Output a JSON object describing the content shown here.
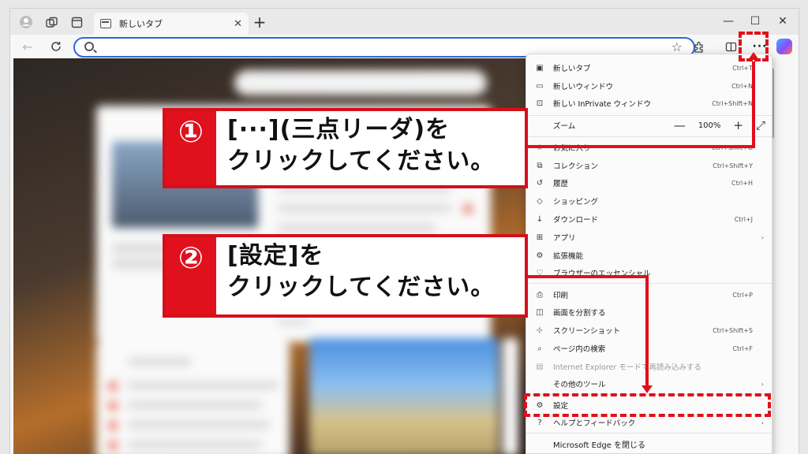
{
  "browser": {
    "tab_title": "新しいタブ",
    "tab_close": "✕",
    "new_tab": "+",
    "window_controls": {
      "minimize": "—",
      "maximize": "☐",
      "close": "✕"
    },
    "more_button_label": "···"
  },
  "menu": {
    "items": [
      {
        "label": "新しいタブ",
        "shortcut": "Ctrl+T",
        "icon": "new-tab-icon",
        "glyph": "▣"
      },
      {
        "label": "新しいウィンドウ",
        "shortcut": "Ctrl+N",
        "icon": "window-icon",
        "glyph": "▭"
      },
      {
        "label": "新しい InPrivate ウィンドウ",
        "shortcut": "Ctrl+Shift+N",
        "icon": "inprivate-icon",
        "glyph": "⊡"
      },
      {
        "label": "ズーム",
        "zoom_value": "100%",
        "zoom_out": "—",
        "zoom_in": "+",
        "fullscreen": "⤢"
      },
      {
        "label": "お気に入り",
        "shortcut": "Ctrl+Shift+O",
        "icon": "favorites-icon",
        "glyph": "☆"
      },
      {
        "label": "コレクション",
        "shortcut": "Ctrl+Shift+Y",
        "icon": "collections-icon",
        "glyph": "⧉"
      },
      {
        "label": "履歴",
        "shortcut": "Ctrl+H",
        "icon": "history-icon",
        "glyph": "↺"
      },
      {
        "label": "ショッピング",
        "shortcut": "",
        "icon": "tag-icon",
        "glyph": "◇"
      },
      {
        "label": "ダウンロード",
        "shortcut": "Ctrl+J",
        "icon": "download-icon",
        "glyph": "↓"
      },
      {
        "label": "アプリ",
        "shortcut": "",
        "icon": "apps-icon",
        "glyph": "⊞",
        "submenu": "›"
      },
      {
        "label": "拡張機能",
        "shortcut": "",
        "icon": "extensions-icon",
        "glyph": "⚙"
      },
      {
        "label": "ブラウザーのエッセンシャル",
        "shortcut": "",
        "icon": "heart-icon",
        "glyph": "♡"
      },
      {
        "label": "印刷",
        "shortcut": "Ctrl+P",
        "icon": "print-icon",
        "glyph": "⎙"
      },
      {
        "label": "画面を分割する",
        "shortcut": "",
        "icon": "split-icon",
        "glyph": "◫"
      },
      {
        "label": "スクリーンショット",
        "shortcut": "Ctrl+Shift+S",
        "icon": "screenshot-icon",
        "glyph": "⊹"
      },
      {
        "label": "ページ内の検索",
        "shortcut": "Ctrl+F",
        "icon": "find-icon",
        "glyph": "⌕"
      },
      {
        "label": "Internet Explorer モードで再読み込みする",
        "shortcut": "",
        "icon": "ie-icon",
        "glyph": "▤",
        "disabled": true
      },
      {
        "label": "その他のツール",
        "shortcut": "",
        "icon": "tools-icon",
        "glyph": "",
        "submenu": "›"
      },
      {
        "label": "設定",
        "shortcut": "",
        "icon": "gear-icon",
        "glyph": "⚙"
      },
      {
        "label": "ヘルプとフィードバック",
        "shortcut": "",
        "icon": "help-icon",
        "glyph": "?",
        "submenu": "›"
      },
      {
        "label": "Microsoft Edge を閉じる",
        "shortcut": "",
        "icon": "",
        "glyph": ""
      }
    ]
  },
  "annotations": {
    "step1": {
      "number": "①",
      "text": "[···](三点リーダ)を\nクリックしてください。"
    },
    "step2": {
      "number": "②",
      "text": "[設定]を\nクリックしてください。"
    },
    "color": "#e0101c"
  }
}
